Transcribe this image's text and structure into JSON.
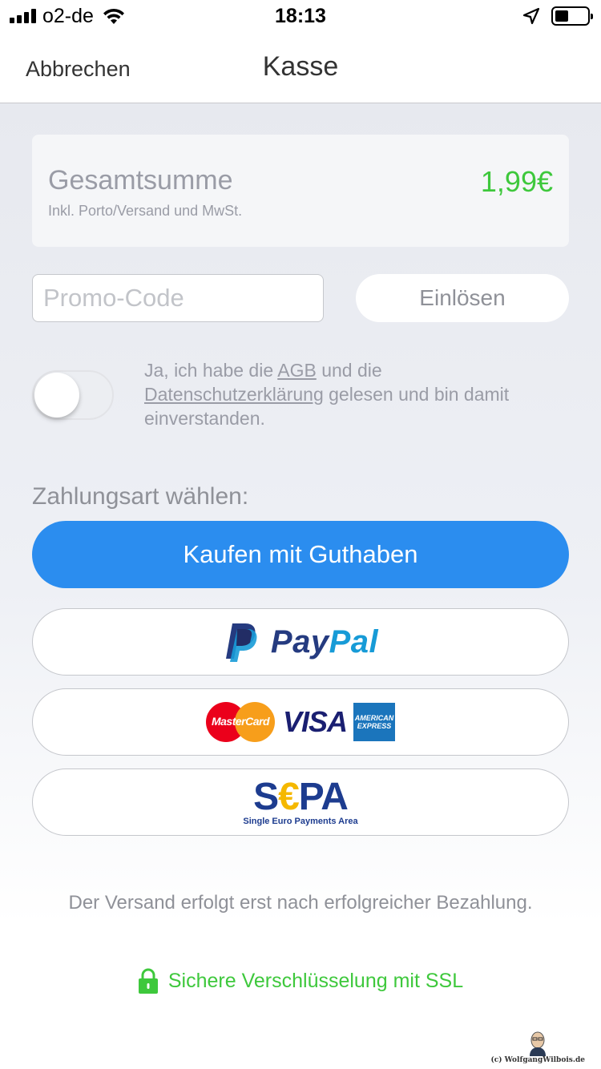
{
  "status_bar": {
    "carrier": "o2-de",
    "time": "18:13"
  },
  "nav": {
    "cancel_label": "Abbrechen",
    "title": "Kasse"
  },
  "total": {
    "label": "Gesamtsumme",
    "sublabel": "Inkl. Porto/Versand und MwSt.",
    "amount": "1,99€",
    "amount_color": "#3ec83c"
  },
  "promo": {
    "placeholder": "Promo-Code",
    "value": "",
    "redeem_label": "Einlösen"
  },
  "terms": {
    "toggle_on": false,
    "text_1": "Ja, ich habe die ",
    "agb_link": "AGB",
    "text_2": " und die ",
    "privacy_link": "Datenschutzerklärung",
    "text_3": " gelesen und bin damit einverstanden."
  },
  "payment": {
    "heading": "Zahlungsart wählen:",
    "credit_label": "Kaufen mit Guthaben",
    "credit_color": "#2b8def",
    "paypal": {
      "pay": "Pay",
      "pal": "Pal"
    },
    "cards": {
      "mastercard": "MasterCard",
      "visa": "VISA",
      "amex_1": "AMERICAN",
      "amex_2": "EXPRESS"
    },
    "sepa": {
      "logo": "SEPA",
      "subtitle": "Single Euro Payments Area"
    }
  },
  "shipping_note": "Der Versand erfolgt erst nach erfolgreicher Bezahlung.",
  "ssl_text": "Sichere Verschlüsselung mit SSL",
  "watermark": "(c) WolfgangWilbois.de"
}
